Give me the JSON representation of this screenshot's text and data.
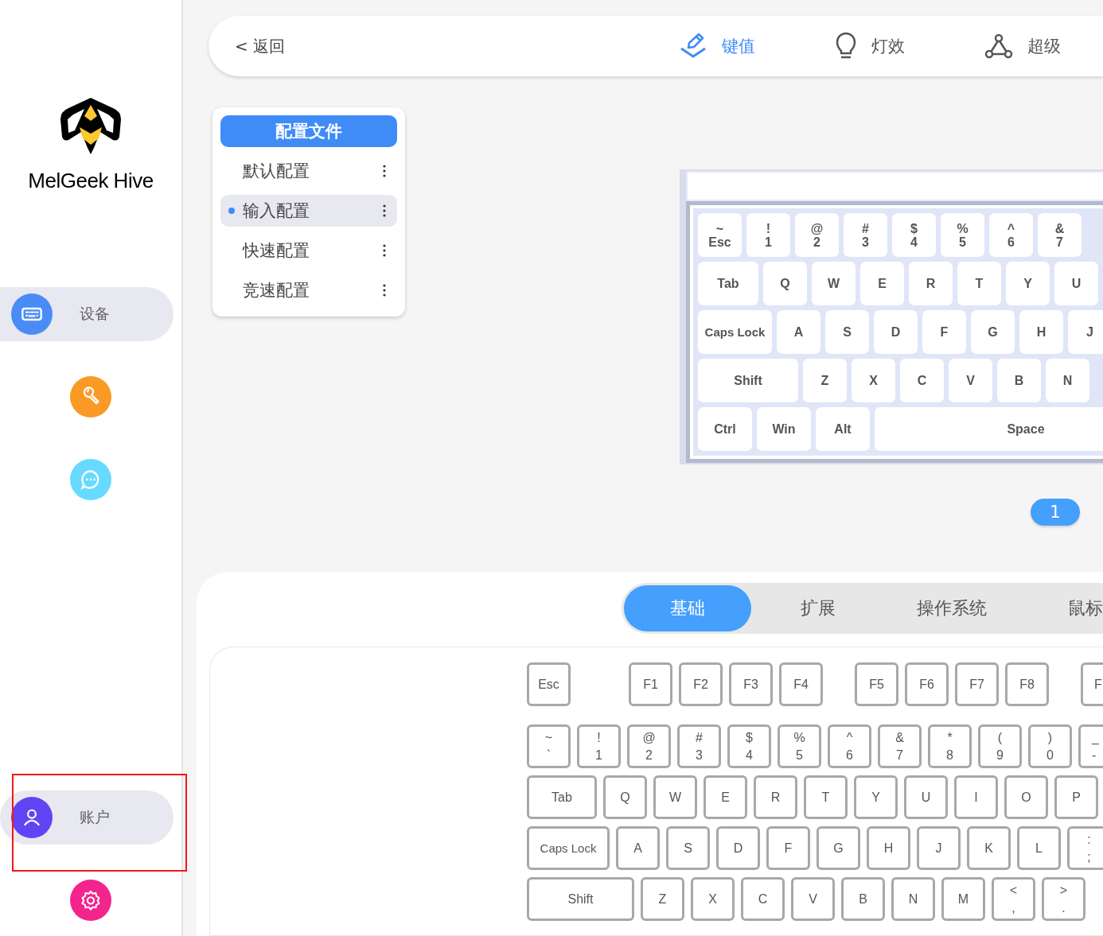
{
  "sidebar": {
    "brand": "MelGeek Hive",
    "items": [
      {
        "kind": "device",
        "label": "设备",
        "color": "#4a8cf7"
      },
      {
        "kind": "tool",
        "color": "#fa9a24"
      },
      {
        "kind": "chat",
        "color": "#66daff"
      },
      {
        "kind": "account",
        "label": "账户",
        "color": "#6244f5",
        "highlighted": true
      },
      {
        "kind": "settings",
        "color": "#f3248d"
      }
    ]
  },
  "topbar": {
    "back": "< 返回",
    "tabs": [
      {
        "kind": "keymap",
        "label": "键值",
        "selected": true
      },
      {
        "kind": "lighting",
        "label": "灯效",
        "selected": false
      },
      {
        "kind": "advanced",
        "label": "超级",
        "selected": false
      }
    ]
  },
  "profiles": {
    "title": "配置文件",
    "items": [
      {
        "label": "默认配置",
        "selected": false
      },
      {
        "label": "输入配置",
        "selected": true
      },
      {
        "label": "快速配置",
        "selected": false
      },
      {
        "label": "竞速配置",
        "selected": false
      }
    ]
  },
  "preview_keyboard": {
    "rows": [
      {
        "keys": [
          {
            "top": "~",
            "label": "Esc"
          },
          {
            "top": "!",
            "label": "1"
          },
          {
            "top": "@",
            "label": "2"
          },
          {
            "top": "#",
            "label": "3"
          },
          {
            "top": "$",
            "label": "4"
          },
          {
            "top": "%",
            "label": "5"
          },
          {
            "top": "^",
            "label": "6"
          },
          {
            "top": "&",
            "label": "7"
          }
        ]
      },
      {
        "keys": [
          {
            "label": "Tab",
            "kind": "w1"
          },
          {
            "label": "Q"
          },
          {
            "label": "W"
          },
          {
            "label": "E"
          },
          {
            "label": "R"
          },
          {
            "label": "T"
          },
          {
            "label": "Y"
          },
          {
            "label": "U"
          }
        ]
      },
      {
        "keys": [
          {
            "label": "Caps Lock",
            "kind": "w2"
          },
          {
            "label": "A"
          },
          {
            "label": "S"
          },
          {
            "label": "D"
          },
          {
            "label": "F"
          },
          {
            "label": "G"
          },
          {
            "label": "H"
          },
          {
            "label": "J"
          }
        ]
      },
      {
        "keys": [
          {
            "label": "Shift",
            "kind": "w3"
          },
          {
            "label": "Z"
          },
          {
            "label": "X"
          },
          {
            "label": "C"
          },
          {
            "label": "V"
          },
          {
            "label": "B"
          },
          {
            "label": "N"
          }
        ]
      },
      {
        "keys": [
          {
            "label": "Ctrl",
            "kind": "w4"
          },
          {
            "label": "Win",
            "kind": "w4"
          },
          {
            "label": "Alt",
            "kind": "w4"
          },
          {
            "label": "Space",
            "kind": "space"
          }
        ]
      }
    ]
  },
  "pages": [
    {
      "label": "1",
      "selected": true
    }
  ],
  "categories": [
    {
      "label": "基础",
      "selected": true
    },
    {
      "label": "扩展",
      "selected": false
    },
    {
      "label": "操作系统",
      "selected": false
    },
    {
      "label": "鼠标",
      "selected": false
    }
  ],
  "key_picker": {
    "function_groups": [
      [
        {
          "label": "Esc"
        }
      ],
      [
        {
          "label": "F1"
        },
        {
          "label": "F2"
        },
        {
          "label": "F3"
        },
        {
          "label": "F4"
        }
      ],
      [
        {
          "label": "F5"
        },
        {
          "label": "F6"
        },
        {
          "label": "F7"
        },
        {
          "label": "F8"
        }
      ],
      [
        {
          "label": "F"
        }
      ]
    ],
    "rows": [
      [
        {
          "top": "~",
          "label": "`"
        },
        {
          "top": "!",
          "label": "1"
        },
        {
          "top": "@",
          "label": "2"
        },
        {
          "top": "#",
          "label": "3"
        },
        {
          "top": "$",
          "label": "4"
        },
        {
          "top": "%",
          "label": "5"
        },
        {
          "top": "^",
          "label": "6"
        },
        {
          "top": "&",
          "label": "7"
        },
        {
          "top": "*",
          "label": "8"
        },
        {
          "top": "(",
          "label": "9"
        },
        {
          "top": ")",
          "label": "0"
        },
        {
          "top": "_",
          "label": "-"
        }
      ],
      [
        {
          "label": "Tab",
          "kind": "w1"
        },
        {
          "label": "Q"
        },
        {
          "label": "W"
        },
        {
          "label": "E"
        },
        {
          "label": "R"
        },
        {
          "label": "T"
        },
        {
          "label": "Y"
        },
        {
          "label": "U"
        },
        {
          "label": "I"
        },
        {
          "label": "O"
        },
        {
          "label": "P"
        }
      ],
      [
        {
          "label": "Caps Lock",
          "kind": "w2"
        },
        {
          "label": "A"
        },
        {
          "label": "S"
        },
        {
          "label": "D"
        },
        {
          "label": "F"
        },
        {
          "label": "G"
        },
        {
          "label": "H"
        },
        {
          "label": "J"
        },
        {
          "label": "K"
        },
        {
          "label": "L"
        },
        {
          "top": ":",
          "label": ";"
        }
      ],
      [
        {
          "label": "Shift",
          "kind": "w3"
        },
        {
          "label": "Z"
        },
        {
          "label": "X"
        },
        {
          "label": "C"
        },
        {
          "label": "V"
        },
        {
          "label": "B"
        },
        {
          "label": "N"
        },
        {
          "label": "M"
        },
        {
          "top": "<",
          "label": ","
        },
        {
          "top": ">",
          "label": "."
        }
      ]
    ]
  }
}
